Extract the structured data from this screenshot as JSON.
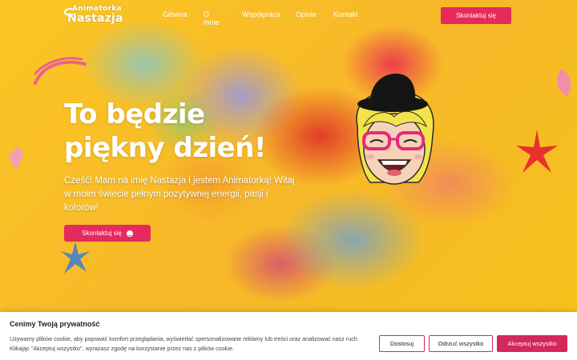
{
  "logo": {
    "line1": "Animatorka",
    "line2": "Nastazja"
  },
  "nav": {
    "items": [
      {
        "label": "Główna"
      },
      {
        "label": "O mnie"
      },
      {
        "label": "Współpraca"
      },
      {
        "label": "Opinie"
      },
      {
        "label": "Kontakt"
      }
    ],
    "cta_label": "Skontaktuj się"
  },
  "hero": {
    "headline_line1": "To będzie",
    "headline_line2": "piękny dzień!",
    "intro": "Cześć! Mam na imię Nastazja i jestem Animatorką! Witaj w moim świecie pełnym pozytywnej energii, pasji i kolorów!",
    "cta_label": "Skontaktuj się"
  },
  "cookie": {
    "title": "Cenimy Twoją prywatność",
    "text": "Używamy plików cookie, aby poprawić komfort przeglądania, wyświetlać spersonalizowane reklamy lub treści oraz analizować nasz ruch. Klikając \"Akceptuj wszystko\", wyrażasz zgodę na korzystanie przez nas z plików cookie.",
    "buttons": {
      "customize": "Dostosuj",
      "reject": "Odrzuć wszystko",
      "accept": "Akceptuj wszystko"
    }
  },
  "colors": {
    "accent": "#e52a5d",
    "background": "#f7c21c"
  }
}
